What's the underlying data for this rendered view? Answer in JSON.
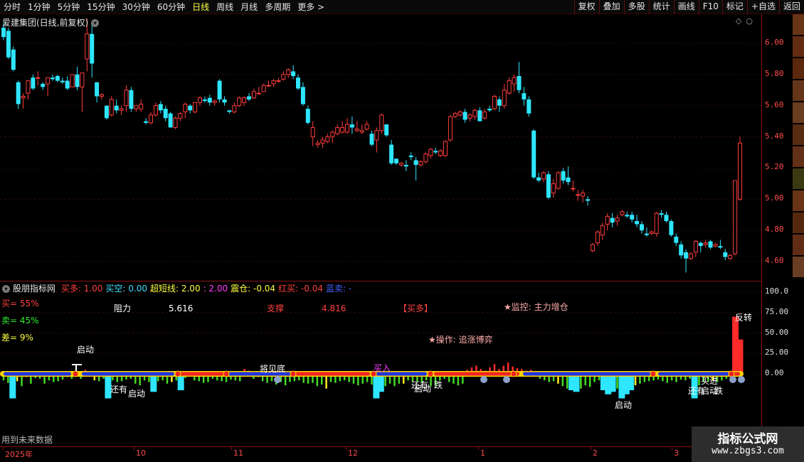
{
  "toolbar": {
    "timeframes": [
      "分时",
      "1分钟",
      "5分钟",
      "15分钟",
      "30分钟",
      "60分钟",
      "日线",
      "周线",
      "月线",
      "多周期",
      "更多 >"
    ],
    "active": "日线",
    "tools": [
      "复权",
      "叠加",
      "多股",
      "统计",
      "画线",
      "F10",
      "标记",
      "+自选",
      "返回"
    ]
  },
  "main_chart": {
    "title": "爱建集团(日线,前复权)",
    "price_axis": [
      "6.00",
      "5.80",
      "5.60",
      "5.40",
      "5.20",
      "5.00",
      "4.80",
      "4.60"
    ]
  },
  "indicator": {
    "name": "股朋指标网",
    "params": [
      {
        "label": "买多:",
        "value": "1.00",
        "color": "#ff4040"
      },
      {
        "label": "买空:",
        "value": "0.00",
        "color": "#40e0ff"
      },
      {
        "label": "超短线:",
        "value": "2.00",
        "color": "#ffff40"
      },
      {
        "label": ":",
        "value": "2.00",
        "color": "#ff40ff"
      },
      {
        "label": "震仓:",
        "value": "-0.04",
        "color": "#ffff40"
      },
      {
        "label": "红买:",
        "value": "-0.04",
        "color": "#ff4040"
      },
      {
        "label": "蓝卖:",
        "value": "-",
        "color": "#4060ff"
      }
    ],
    "ratios": {
      "buy": "买= 55%",
      "sell": "卖= 45%",
      "diff": "差= 9%"
    },
    "resistance": {
      "label": "阻力",
      "value": "5.616"
    },
    "support": {
      "label": "支撑",
      "value": "4.816"
    },
    "status": "【买多】",
    "monitor": "★监控: 主力增仓",
    "operation": "★操作: 追涨博弈",
    "axis": [
      "100.0",
      "75.00",
      "50.00",
      "25.00",
      "0.00"
    ],
    "signals": [
      {
        "text": "启动",
        "color": "#ffffff"
      },
      {
        "text": "还有",
        "color": "#ffffff"
      },
      {
        "text": "启动",
        "color": "#ffffff"
      },
      {
        "text": "将见底",
        "color": "#ffffff"
      },
      {
        "text": "买入",
        "color": "#ff40ff"
      },
      {
        "text": "还有",
        "color": "#ffffff"
      },
      {
        "text": "启动",
        "color": "#ffffff"
      },
      {
        "text": "跌",
        "color": "#ffffff"
      },
      {
        "text": "启动",
        "color": "#ffffff"
      },
      {
        "text": "还有",
        "color": "#ffffff"
      },
      {
        "text": "启动",
        "color": "#ffffff"
      },
      {
        "text": "买进",
        "color": "#ffffff"
      },
      {
        "text": "跌",
        "color": "#ffffff"
      },
      {
        "text": "反转",
        "color": "#ffffff"
      }
    ],
    "future_note": "用到未来数据"
  },
  "time_axis": [
    "2025年",
    "10",
    "11",
    "12",
    "1",
    "2",
    "3"
  ],
  "watermark": {
    "line1": "指标公式网",
    "line2": "www.zbgs3.com"
  },
  "chart_data": {
    "type": "candlestick",
    "ylim": [
      4.5,
      6.15
    ],
    "ohlc": [
      [
        6.1,
        6.13,
        6.02,
        6.04
      ],
      [
        6.08,
        6.1,
        5.9,
        5.91
      ],
      [
        5.96,
        5.98,
        5.82,
        5.83
      ],
      [
        5.75,
        5.76,
        5.58,
        5.61
      ],
      [
        5.65,
        5.68,
        5.58,
        5.66
      ],
      [
        5.68,
        5.76,
        5.64,
        5.76
      ],
      [
        5.78,
        5.8,
        5.7,
        5.71
      ],
      [
        5.78,
        5.82,
        5.73,
        5.78
      ],
      [
        5.74,
        5.75,
        5.7,
        5.72
      ],
      [
        5.74,
        5.78,
        5.66,
        5.78
      ],
      [
        5.78,
        5.8,
        5.76,
        5.77
      ],
      [
        5.79,
        5.8,
        5.75,
        5.76
      ],
      [
        5.76,
        5.78,
        5.74,
        5.75
      ],
      [
        5.76,
        5.79,
        5.7,
        5.71
      ],
      [
        5.72,
        5.8,
        5.72,
        5.8
      ],
      [
        5.8,
        5.85,
        5.7,
        5.72
      ],
      [
        5.72,
        5.76,
        5.56,
        5.81
      ],
      [
        5.9,
        6.16,
        5.82,
        6.06
      ],
      [
        6.06,
        6.12,
        5.78,
        5.87
      ],
      [
        5.75,
        5.75,
        5.62,
        5.66
      ],
      [
        5.66,
        5.68,
        5.64,
        5.67
      ],
      [
        5.6,
        5.6,
        5.51,
        5.52
      ],
      [
        5.54,
        5.66,
        5.53,
        5.64
      ],
      [
        5.6,
        5.64,
        5.55,
        5.57
      ],
      [
        5.57,
        5.6,
        5.54,
        5.58
      ],
      [
        5.6,
        5.73,
        5.56,
        5.7
      ],
      [
        5.7,
        5.72,
        5.56,
        5.58
      ],
      [
        5.58,
        5.6,
        5.56,
        5.6
      ],
      [
        5.58,
        5.64,
        5.56,
        5.61
      ],
      [
        5.5,
        5.52,
        5.48,
        5.49
      ],
      [
        5.49,
        5.56,
        5.48,
        5.54
      ],
      [
        5.54,
        5.62,
        5.53,
        5.6
      ],
      [
        5.61,
        5.63,
        5.55,
        5.57
      ],
      [
        5.58,
        5.6,
        5.5,
        5.52
      ],
      [
        5.55,
        5.56,
        5.46,
        5.46
      ],
      [
        5.46,
        5.53,
        5.45,
        5.52
      ],
      [
        5.52,
        5.56,
        5.5,
        5.55
      ],
      [
        5.56,
        5.62,
        5.52,
        5.61
      ],
      [
        5.6,
        5.61,
        5.55,
        5.57
      ],
      [
        5.56,
        5.62,
        5.55,
        5.62
      ],
      [
        5.62,
        5.66,
        5.6,
        5.65
      ],
      [
        5.64,
        5.66,
        5.62,
        5.63
      ],
      [
        5.65,
        5.67,
        5.6,
        5.62
      ],
      [
        5.62,
        5.64,
        5.6,
        5.63
      ],
      [
        5.76,
        5.77,
        5.62,
        5.64
      ],
      [
        5.64,
        5.66,
        5.6,
        5.62
      ],
      [
        5.57,
        5.57,
        5.55,
        5.56
      ],
      [
        5.56,
        5.62,
        5.55,
        5.6
      ],
      [
        5.6,
        5.66,
        5.59,
        5.65
      ],
      [
        5.62,
        5.66,
        5.6,
        5.65
      ],
      [
        5.66,
        5.68,
        5.63,
        5.64
      ],
      [
        5.65,
        5.71,
        5.64,
        5.69
      ],
      [
        5.68,
        5.72,
        5.67,
        5.68
      ],
      [
        5.69,
        5.74,
        5.69,
        5.73
      ],
      [
        5.73,
        5.76,
        5.72,
        5.73
      ],
      [
        5.74,
        5.77,
        5.72,
        5.76
      ],
      [
        5.76,
        5.78,
        5.75,
        5.76
      ],
      [
        5.77,
        5.82,
        5.76,
        5.8
      ],
      [
        5.8,
        5.84,
        5.78,
        5.83
      ],
      [
        5.82,
        5.86,
        5.77,
        5.79
      ],
      [
        5.78,
        5.8,
        5.7,
        5.71
      ],
      [
        5.72,
        5.75,
        5.6,
        5.61
      ],
      [
        5.58,
        5.6,
        5.48,
        5.49
      ],
      [
        5.4,
        5.5,
        5.34,
        5.46
      ],
      [
        5.35,
        5.38,
        5.33,
        5.36
      ],
      [
        5.36,
        5.4,
        5.33,
        5.38
      ],
      [
        5.37,
        5.42,
        5.36,
        5.4
      ],
      [
        5.4,
        5.44,
        5.36,
        5.43
      ],
      [
        5.42,
        5.48,
        5.41,
        5.46
      ],
      [
        5.43,
        5.5,
        5.42,
        5.46
      ],
      [
        5.43,
        5.52,
        5.42,
        5.48
      ],
      [
        5.48,
        5.53,
        5.42,
        5.46
      ],
      [
        5.44,
        5.5,
        5.43,
        5.45
      ],
      [
        5.43,
        5.48,
        5.42,
        5.44
      ],
      [
        5.45,
        5.5,
        5.44,
        5.48
      ],
      [
        5.42,
        5.44,
        5.34,
        5.35
      ],
      [
        5.38,
        5.46,
        5.3,
        5.44
      ],
      [
        5.44,
        5.55,
        5.42,
        5.54
      ],
      [
        5.48,
        5.48,
        5.4,
        5.41
      ],
      [
        5.35,
        5.38,
        5.22,
        5.23
      ],
      [
        5.26,
        5.26,
        5.22,
        5.23
      ],
      [
        5.22,
        5.24,
        5.21,
        5.23
      ],
      [
        5.22,
        5.25,
        5.18,
        5.21
      ],
      [
        5.28,
        5.3,
        5.25,
        5.27
      ],
      [
        5.25,
        5.27,
        5.12,
        5.22
      ],
      [
        5.22,
        5.25,
        5.21,
        5.24
      ],
      [
        5.24,
        5.3,
        5.23,
        5.29
      ],
      [
        5.28,
        5.33,
        5.26,
        5.32
      ],
      [
        5.31,
        5.33,
        5.29,
        5.3
      ],
      [
        5.28,
        5.32,
        5.27,
        5.31
      ],
      [
        5.28,
        5.38,
        5.27,
        5.37
      ],
      [
        5.38,
        5.54,
        5.37,
        5.53
      ],
      [
        5.53,
        5.56,
        5.52,
        5.55
      ],
      [
        5.54,
        5.57,
        5.53,
        5.56
      ],
      [
        5.56,
        5.58,
        5.49,
        5.51
      ],
      [
        5.52,
        5.55,
        5.5,
        5.54
      ],
      [
        5.53,
        5.58,
        5.51,
        5.57
      ],
      [
        5.57,
        5.59,
        5.5,
        5.5
      ],
      [
        5.52,
        5.58,
        5.51,
        5.56
      ],
      [
        5.58,
        5.6,
        5.56,
        5.57
      ],
      [
        5.58,
        5.67,
        5.57,
        5.66
      ],
      [
        5.64,
        5.66,
        5.56,
        5.6
      ],
      [
        5.6,
        5.74,
        5.58,
        5.7
      ],
      [
        5.68,
        5.78,
        5.67,
        5.76
      ],
      [
        5.74,
        5.8,
        5.69,
        5.78
      ],
      [
        5.79,
        5.88,
        5.68,
        5.7
      ],
      [
        5.68,
        5.72,
        5.6,
        5.64
      ],
      [
        5.64,
        5.66,
        5.53,
        5.55
      ],
      [
        5.44,
        5.45,
        5.13,
        5.14
      ],
      [
        5.14,
        5.17,
        5.11,
        5.12
      ],
      [
        5.13,
        5.18,
        5.11,
        5.17
      ],
      [
        5.16,
        5.18,
        5.0,
        5.01
      ],
      [
        5.04,
        5.13,
        5.01,
        5.1
      ],
      [
        5.07,
        5.18,
        5.06,
        5.17
      ],
      [
        5.18,
        5.2,
        5.1,
        5.12
      ],
      [
        5.14,
        5.21,
        5.09,
        5.11
      ],
      [
        5.07,
        5.12,
        5.05,
        5.07
      ],
      [
        5.03,
        5.06,
        4.99,
        5.03
      ],
      [
        5.02,
        5.06,
        4.98,
        5.04
      ],
      [
        5.0,
        5.02,
        4.96,
        4.99
      ],
      [
        4.67,
        4.72,
        4.66,
        4.71
      ],
      [
        4.72,
        4.8,
        4.7,
        4.79
      ],
      [
        4.77,
        4.85,
        4.74,
        4.83
      ],
      [
        4.84,
        4.91,
        4.8,
        4.89
      ],
      [
        4.88,
        4.91,
        4.82,
        4.85
      ],
      [
        4.86,
        4.9,
        4.83,
        4.88
      ],
      [
        4.9,
        4.93,
        4.89,
        4.92
      ],
      [
        4.9,
        4.92,
        4.88,
        4.89
      ],
      [
        4.9,
        4.92,
        4.85,
        4.87
      ],
      [
        4.86,
        4.9,
        4.82,
        4.84
      ],
      [
        4.84,
        4.86,
        4.78,
        4.8
      ],
      [
        4.78,
        4.82,
        4.76,
        4.77
      ],
      [
        4.78,
        4.8,
        4.77,
        4.79
      ],
      [
        4.78,
        4.92,
        4.76,
        4.91
      ],
      [
        4.91,
        4.93,
        4.88,
        4.9
      ],
      [
        4.9,
        4.92,
        4.85,
        4.86
      ],
      [
        4.86,
        4.87,
        4.76,
        4.77
      ],
      [
        4.76,
        4.78,
        4.7,
        4.72
      ],
      [
        4.71,
        4.73,
        4.62,
        4.64
      ],
      [
        4.66,
        4.68,
        4.53,
        4.62
      ],
      [
        4.62,
        4.66,
        4.61,
        4.65
      ],
      [
        4.66,
        4.74,
        4.63,
        4.73
      ],
      [
        4.72,
        4.73,
        4.66,
        4.7
      ],
      [
        4.71,
        4.74,
        4.69,
        4.72
      ],
      [
        4.73,
        4.74,
        4.68,
        4.69
      ],
      [
        4.7,
        4.72,
        4.69,
        4.71
      ],
      [
        4.7,
        4.74,
        4.68,
        4.69
      ],
      [
        4.66,
        4.68,
        4.61,
        4.63
      ],
      [
        4.62,
        4.65,
        4.61,
        4.64
      ],
      [
        4.65,
        5.12,
        4.64,
        5.12
      ],
      [
        5.0,
        5.4,
        4.99,
        5.36
      ]
    ],
    "indicator_bars": [
      -8,
      -11,
      -30,
      -9,
      -15,
      -4,
      -12,
      -5,
      -6,
      -12,
      -8,
      -10,
      -9,
      -7,
      -4,
      -6,
      -3,
      -6,
      5,
      -3,
      -8,
      -9,
      -6,
      -30,
      -8,
      -10,
      -9,
      -7,
      -6,
      -12,
      -14,
      -8,
      -10,
      -22,
      -9,
      -8,
      -12,
      -10,
      -8,
      -20,
      -5,
      -3,
      -8,
      -9,
      -11,
      -10,
      -6,
      -8,
      -9,
      -10,
      -7,
      -8,
      -9,
      6,
      4,
      -6,
      -4,
      -9,
      -11,
      -9,
      -13,
      -10,
      -14,
      -10,
      -9,
      -8,
      -11,
      -12,
      -11,
      -15,
      -13,
      -18,
      -10,
      -11,
      -9,
      -8,
      -10,
      -12,
      -14,
      -12,
      -10,
      -13,
      -30,
      -22,
      -15,
      -12,
      -15,
      -12,
      -12,
      -8,
      -10,
      -9,
      -11,
      -8,
      -15,
      -14,
      -8,
      -6,
      -10,
      -12,
      -14,
      -12,
      5,
      8,
      10,
      6,
      4,
      8,
      12,
      6,
      10,
      14,
      9,
      7,
      6,
      4,
      5,
      3,
      -6,
      -8,
      -10,
      -9,
      -12,
      -15,
      -18,
      -20,
      -22,
      -18,
      -14,
      -16,
      -10,
      -8,
      -20,
      -25,
      -22,
      -18,
      -30,
      -25,
      -20,
      -14,
      -12,
      -10,
      -9,
      -8,
      -7,
      -9,
      -11,
      -8,
      -10,
      -7,
      -8,
      -6,
      -30,
      -14,
      -10,
      -9,
      -8,
      -10,
      -8,
      -6,
      -6,
      70,
      42
    ]
  }
}
